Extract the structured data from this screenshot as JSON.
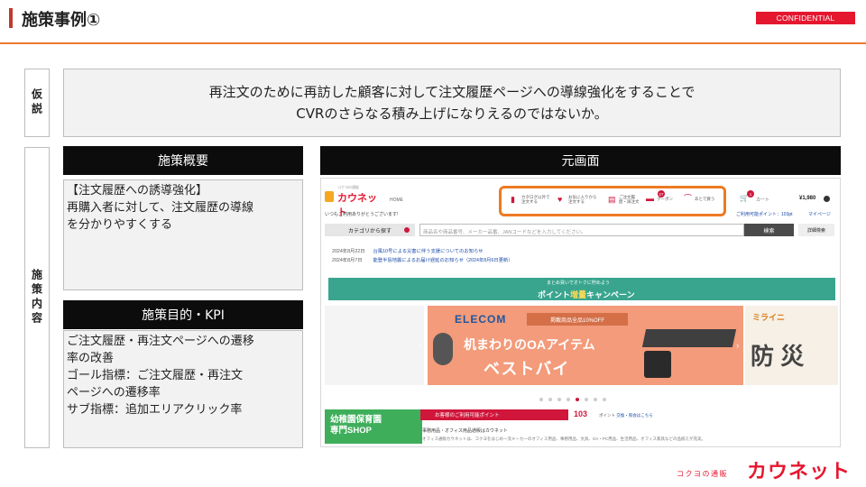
{
  "header": {
    "title": "施策事例①",
    "confidential": "CONFIDENTIAL"
  },
  "hypothesis": {
    "label": "仮説",
    "line1": "再注文のために再訪した顧客に対して注文履歴ページへの導線強化をすることで",
    "line2": "CVRのさらなる積み上げになりえるのではないか。"
  },
  "measure": {
    "label": "施策内容",
    "overview_title": "施策概要",
    "overview_line1": "【注文履歴への誘導強化】",
    "overview_line2": "再購入者に対して、注文履歴の導線",
    "overview_line3": "を分かりやすくする",
    "kpi_title": "施策目的・KPI",
    "kpi_line1": "ご注文履歴・再注文ページへの遷移",
    "kpi_line2": "率の改善",
    "kpi_line3": "ゴール指標：ご注文履歴・再注文",
    "kpi_line4": "ページへの遷移率",
    "kpi_line5": "サブ指標：追加エリアクリック率"
  },
  "screen": {
    "title": "元画面",
    "logo": "カウネット",
    "logo_sub": "コクヨの通販",
    "home": "HOME",
    "welcome": "いつもご利用ありがとうございます!",
    "nav": [
      {
        "icon": "book-icon",
        "label": "カタログ以外で注文する"
      },
      {
        "icon": "heart-icon",
        "label": "お気に入りから注文する"
      },
      {
        "icon": "document-icon",
        "label": "ご注文履歴・再注文"
      },
      {
        "icon": "coupon-icon",
        "label": "クーポン"
      },
      {
        "icon": "clip-icon",
        "label": "あとで買う"
      }
    ],
    "coupon_count": "27",
    "cart_label": "カート",
    "cart_count": "1",
    "cart_total": "¥1,980",
    "points_link": "ご利用可能ポイント：103pt",
    "mypage": "マイページ",
    "category_btn": "カテゴリから探す",
    "search_placeholder": "商品名や商品番号、メーカー品番、JANコードなどを入力してください。",
    "search_btn": "検索",
    "advanced_btn": "詳細検索",
    "news": [
      {
        "date": "2024年8月22日",
        "text": "台風10号による災害に伴う支援についてのお知らせ"
      },
      {
        "date": "2024年8月7日",
        "text": "能登半島地震によるお届け遅延のお知らせ（2024年8月6日更新）"
      }
    ],
    "banner_sub": "まとめ買いでオトクに貯めよう",
    "banner_main": "ポイント",
    "banner_hl": "増量",
    "banner_tail": "キャンペーン",
    "hero_brand": "ELECOM",
    "hero_pill": "掲載商品全品10%OFF",
    "hero_line1": "机まわりのOAアイテム",
    "hero_line2": "ベストバイ",
    "hero_right_top": "ミライニ",
    "hero_right_kanji": "防 災",
    "kinder_line1": "幼稚園保育園",
    "kinder_line2": "専門SHOP",
    "points_label": "お客様のご利用可能ポイント",
    "points_value": "103",
    "points_unit": "ポイント",
    "points_note": "交換・照会はこちら",
    "corp_line": "事務用品・オフィス用品通販はカウネット",
    "corp_desc": "オフィス通販カウネットは、コクヨをはじめ一流メーカーのオフィス用品、事務用品、文具、OA・PC用品、生活用品、オフィス家具などの品揃えが充実。"
  },
  "footer": {
    "sub": "コクヨの通販",
    "logo": "カウネット"
  },
  "colors": {
    "accent_red": "#e5172f",
    "accent_orange": "#ec7a2e",
    "highlight_orange": "#ee7a23"
  }
}
